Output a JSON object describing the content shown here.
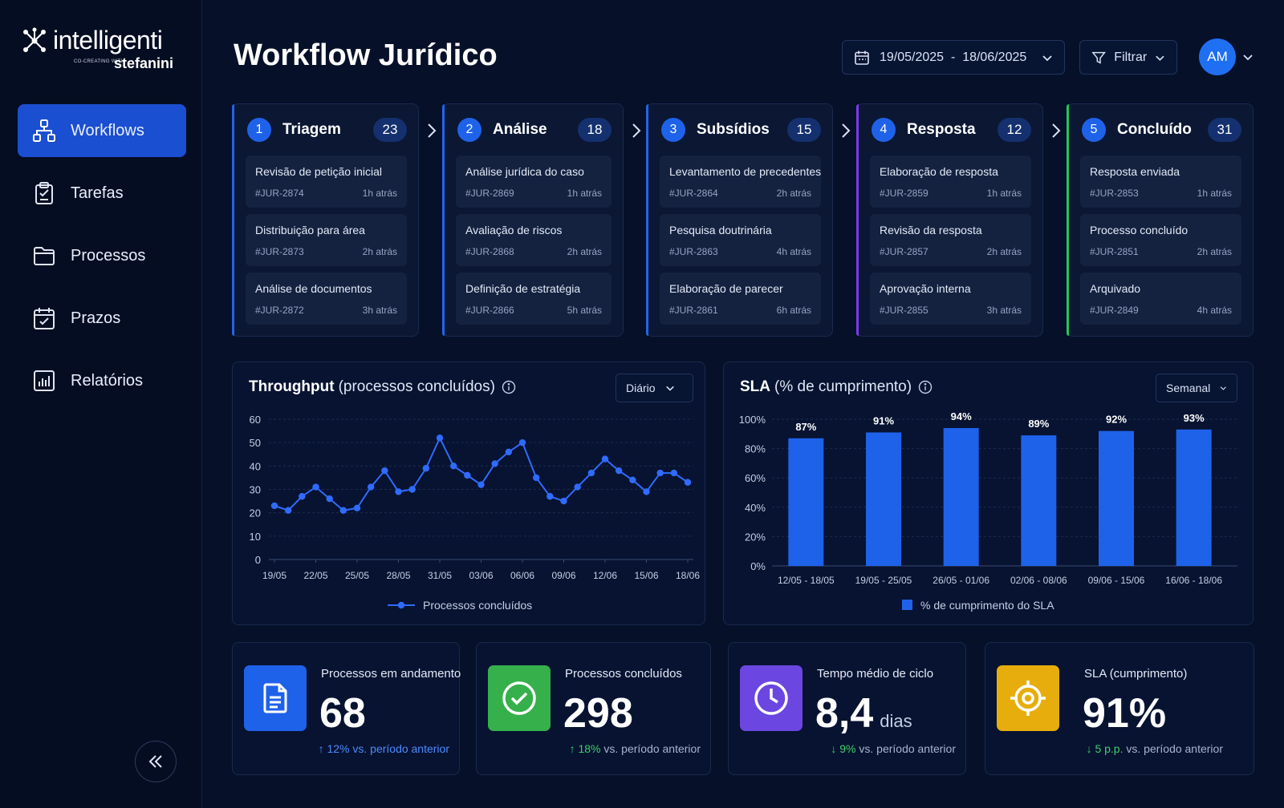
{
  "brand": {
    "name": "intelligenti",
    "sub": "co-creating with",
    "company": "stefanini"
  },
  "nav": {
    "items": [
      {
        "label": "Workflows",
        "icon": "workflow-icon",
        "active": true
      },
      {
        "label": "Tarefas",
        "icon": "clipboard-icon",
        "active": false
      },
      {
        "label": "Processos",
        "icon": "folder-icon",
        "active": false
      },
      {
        "label": "Prazos",
        "icon": "calendar-check-icon",
        "active": false
      },
      {
        "label": "Relatórios",
        "icon": "bar-chart-icon",
        "active": false
      }
    ],
    "collapse_icon": "double-chevron-left-icon"
  },
  "header": {
    "title": "Workflow Jurídico",
    "date_range": "19/05/2025  -  18/06/2025",
    "filter_label": "Filtrar",
    "avatar_initials": "AM"
  },
  "stages": [
    {
      "num": "1",
      "name": "Triagem",
      "count": "23",
      "accent": "#2563eb",
      "tasks": [
        {
          "title": "Revisão de petição inicial",
          "id": "#JUR-2874",
          "time": "1h atrás"
        },
        {
          "title": "Distribuição para área",
          "id": "#JUR-2873",
          "time": "2h atrás"
        },
        {
          "title": "Análise de documentos",
          "id": "#JUR-2872",
          "time": "3h atrás"
        }
      ]
    },
    {
      "num": "2",
      "name": "Análise",
      "count": "18",
      "accent": "#2563eb",
      "tasks": [
        {
          "title": "Análise jurídica do caso",
          "id": "#JUR-2869",
          "time": "1h atrás"
        },
        {
          "title": "Avaliação de riscos",
          "id": "#JUR-2868",
          "time": "2h atrás"
        },
        {
          "title": "Definição de estratégia",
          "id": "#JUR-2866",
          "time": "5h atrás"
        }
      ]
    },
    {
      "num": "3",
      "name": "Subsídios",
      "count": "15",
      "accent": "#2563eb",
      "tasks": [
        {
          "title": "Levantamento de precedentes",
          "id": "#JUR-2864",
          "time": "2h atrás"
        },
        {
          "title": "Pesquisa doutrinária",
          "id": "#JUR-2863",
          "time": "4h atrás"
        },
        {
          "title": "Elaboração de parecer",
          "id": "#JUR-2861",
          "time": "6h atrás"
        }
      ]
    },
    {
      "num": "4",
      "name": "Resposta",
      "count": "12",
      "accent": "#7c3aed",
      "tasks": [
        {
          "title": "Elaboração de resposta",
          "id": "#JUR-2859",
          "time": "1h atrás"
        },
        {
          "title": "Revisão da resposta",
          "id": "#JUR-2857",
          "time": "2h atrás"
        },
        {
          "title": "Aprovação interna",
          "id": "#JUR-2855",
          "time": "3h atrás"
        }
      ]
    },
    {
      "num": "5",
      "name": "Concluído",
      "count": "31",
      "accent": "#22c55e",
      "tasks": [
        {
          "title": "Resposta enviada",
          "id": "#JUR-2853",
          "time": "1h atrás"
        },
        {
          "title": "Processo concluído",
          "id": "#JUR-2851",
          "time": "2h atrás"
        },
        {
          "title": "Arquivado",
          "id": "#JUR-2849",
          "time": "4h atrás"
        }
      ]
    }
  ],
  "throughput": {
    "title_bold": "Throughput",
    "title_light": "(processos concluídos)",
    "select": "Diário"
  },
  "sla": {
    "title_bold": "SLA",
    "title_light": "(% de cumprimento)",
    "select": "Semanal"
  },
  "chart_data": [
    {
      "type": "line",
      "title": "Throughput (processos concluídos)",
      "x_ticks": [
        "19/05",
        "22/05",
        "25/05",
        "28/05",
        "31/05",
        "03/06",
        "06/06",
        "09/06",
        "12/06",
        "15/06",
        "18/06"
      ],
      "y_ticks": [
        "0",
        "10",
        "20",
        "30",
        "40",
        "50",
        "60"
      ],
      "ylim": [
        0,
        60
      ],
      "series": [
        {
          "name": "Processos concluídos",
          "color": "#2f6bff",
          "values": [
            23,
            21,
            27,
            31,
            26,
            21,
            22,
            31,
            38,
            29,
            30,
            39,
            52,
            40,
            36,
            32,
            41,
            46,
            50,
            35,
            27,
            25,
            31,
            37,
            43,
            38,
            34,
            29,
            37,
            37,
            33
          ]
        }
      ],
      "grid": true,
      "legend": "bottom"
    },
    {
      "type": "bar",
      "title": "SLA (% de cumprimento)",
      "categories": [
        "12/05 - 18/05",
        "19/05 - 25/05",
        "26/05 - 01/06",
        "02/06 - 08/06",
        "09/06 - 15/06",
        "16/06 - 18/06"
      ],
      "y_ticks": [
        "0%",
        "20%",
        "40%",
        "60%",
        "80%",
        "100%"
      ],
      "ylim": [
        0,
        100
      ],
      "series": [
        {
          "name": "% de cumprimento do SLA",
          "color": "#1f62ea",
          "values": [
            87,
            91,
            94,
            89,
            92,
            93
          ],
          "labels": [
            "87%",
            "91%",
            "94%",
            "89%",
            "92%",
            "93%"
          ]
        }
      ],
      "grid": true,
      "legend": "bottom"
    }
  ],
  "kpis": [
    {
      "label": "Processos em andamento",
      "value": "68",
      "unit": "",
      "trend_value": "12%",
      "trend_rest": " vs. período anterior",
      "trend_dir": "up",
      "trend_color": "#4d8bff",
      "icon": "document-icon",
      "icon_bg": "#1f62ea"
    },
    {
      "label": "Processos concluídos",
      "value": "298",
      "unit": "",
      "trend_value": "18%",
      "trend_rest": " vs. período anterior",
      "trend_dir": "up",
      "trend_color": "#3ecf6a",
      "icon": "check-circle-icon",
      "icon_bg": "#35b04b"
    },
    {
      "label": "Tempo médio de ciclo",
      "value": "8,4",
      "unit": "dias",
      "trend_value": "9%",
      "trend_rest": " vs. período anterior",
      "trend_dir": "down",
      "trend_color": "#3ecf6a",
      "icon": "clock-icon",
      "icon_bg": "#6b46e0"
    },
    {
      "label": "SLA (cumprimento)",
      "value": "91%",
      "unit": "",
      "trend_value": "5 p.p.",
      "trend_rest": " vs. período anterior",
      "trend_dir": "down",
      "trend_color": "#3ecf6a",
      "icon": "target-icon",
      "icon_bg": "#e7ad0c"
    }
  ]
}
